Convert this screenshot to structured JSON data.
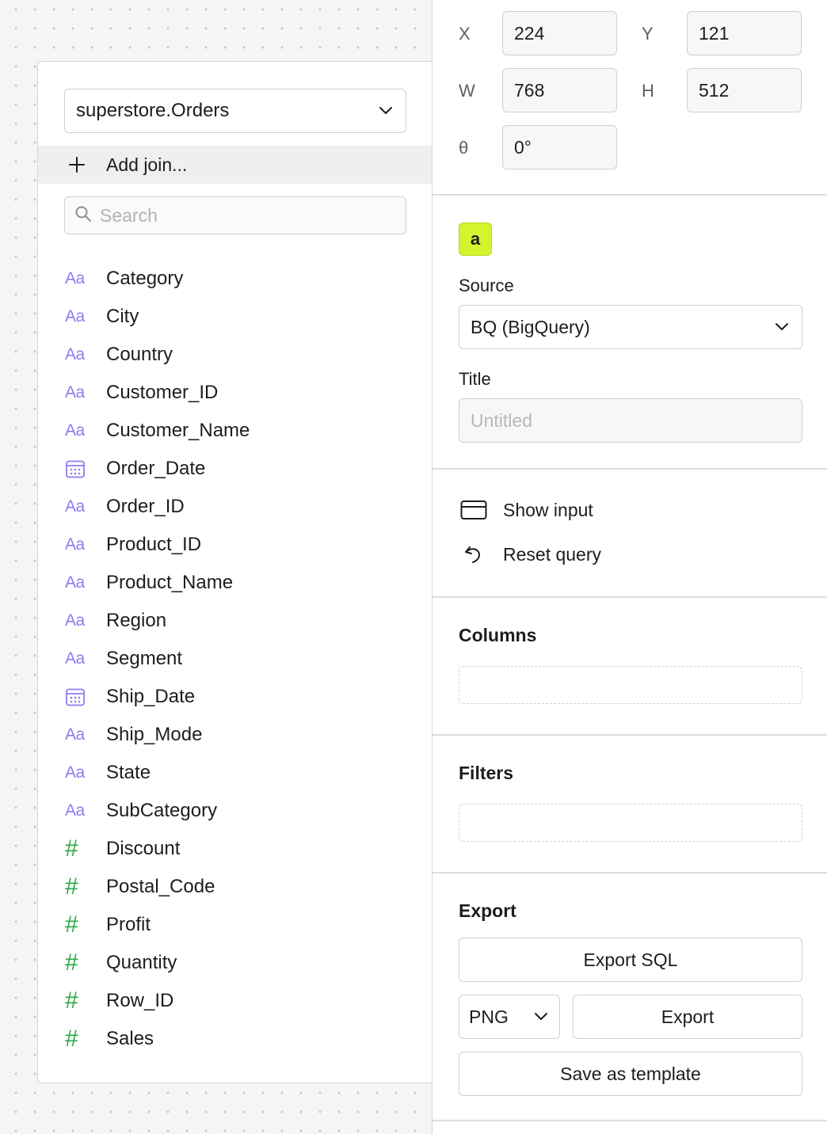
{
  "fields_panel": {
    "table_select": {
      "value": "superstore.Orders"
    },
    "add_join_label": "Add join...",
    "search_placeholder": "Search",
    "fields": [
      {
        "name": "Category",
        "type": "text",
        "type_glyph": "Aa"
      },
      {
        "name": "City",
        "type": "text",
        "type_glyph": "Aa"
      },
      {
        "name": "Country",
        "type": "text",
        "type_glyph": "Aa"
      },
      {
        "name": "Customer_ID",
        "type": "text",
        "type_glyph": "Aa"
      },
      {
        "name": "Customer_Name",
        "type": "text",
        "type_glyph": "Aa"
      },
      {
        "name": "Order_Date",
        "type": "date",
        "type_glyph": "calendar-icon"
      },
      {
        "name": "Order_ID",
        "type": "text",
        "type_glyph": "Aa"
      },
      {
        "name": "Product_ID",
        "type": "text",
        "type_glyph": "Aa"
      },
      {
        "name": "Product_Name",
        "type": "text",
        "type_glyph": "Aa"
      },
      {
        "name": "Region",
        "type": "text",
        "type_glyph": "Aa"
      },
      {
        "name": "Segment",
        "type": "text",
        "type_glyph": "Aa"
      },
      {
        "name": "Ship_Date",
        "type": "date",
        "type_glyph": "calendar-icon"
      },
      {
        "name": "Ship_Mode",
        "type": "text",
        "type_glyph": "Aa"
      },
      {
        "name": "State",
        "type": "text",
        "type_glyph": "Aa"
      },
      {
        "name": "SubCategory",
        "type": "text",
        "type_glyph": "Aa"
      },
      {
        "name": "Discount",
        "type": "number",
        "type_glyph": "#"
      },
      {
        "name": "Postal_Code",
        "type": "number",
        "type_glyph": "#"
      },
      {
        "name": "Profit",
        "type": "number",
        "type_glyph": "#"
      },
      {
        "name": "Quantity",
        "type": "number",
        "type_glyph": "#"
      },
      {
        "name": "Row_ID",
        "type": "number",
        "type_glyph": "#"
      },
      {
        "name": "Sales",
        "type": "number",
        "type_glyph": "#"
      }
    ]
  },
  "inspector": {
    "geometry": {
      "x_label": "X",
      "x_value": "224",
      "y_label": "Y",
      "y_value": "121",
      "w_label": "W",
      "w_value": "768",
      "h_label": "H",
      "h_value": "512",
      "rotation_label": "θ",
      "rotation_value": "0°"
    },
    "alias": "a",
    "source_label": "Source",
    "source_value": "BQ (BigQuery)",
    "title_label": "Title",
    "title_placeholder": "Untitled",
    "title_value": "",
    "show_input_label": "Show input",
    "reset_query_label": "Reset query",
    "columns_label": "Columns",
    "filters_label": "Filters",
    "export": {
      "label": "Export",
      "export_sql_label": "Export SQL",
      "format_value": "PNG",
      "export_button_label": "Export",
      "save_template_label": "Save as template"
    }
  },
  "colors": {
    "alias_chip": "#d4f42e",
    "text_type": "#8b7cf0",
    "number_type": "#2ea84a"
  }
}
